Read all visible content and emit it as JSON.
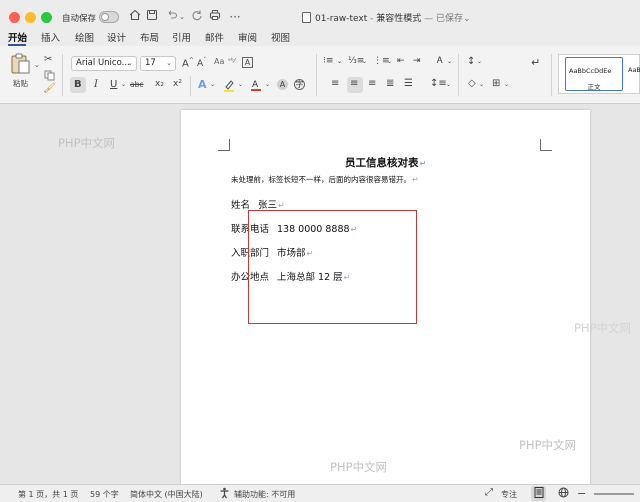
{
  "titlebar": {
    "autosave_label": "自动保存",
    "file_name": "01-raw-text",
    "separator": " - ",
    "mode": "兼容性模式",
    "status": " — 已保存",
    "status_chevron": "⌄"
  },
  "tabs": [
    "开始",
    "插入",
    "绘图",
    "设计",
    "布局",
    "引用",
    "邮件",
    "审阅",
    "视图"
  ],
  "ribbon": {
    "paste_label": "粘贴",
    "font_name": "Arial Unico...",
    "font_size": "17",
    "bold": "B",
    "italic": "I",
    "underline": "U",
    "strike": "abc",
    "subscript": "x₂",
    "superscript": "x²",
    "style_sample": "AaBbCcDdEe",
    "style_name": "正文",
    "style_next_sample": "AaBb"
  },
  "document": {
    "heading": "员工信息核对表",
    "note": "未处理前，标签长短不一样，后面的内容很容易错开。",
    "paragraph_mark": "↵",
    "fields": [
      {
        "label": "姓名",
        "value": "张三"
      },
      {
        "label": "联系电话",
        "value": "138 0000 8888"
      },
      {
        "label": "入职部门",
        "value": "市场部"
      },
      {
        "label": "办公地点",
        "value": "上海总部   12 层"
      }
    ]
  },
  "watermarks": [
    "PHP中文网",
    "PHP中文网",
    "PHP中文网",
    "PHP中文网"
  ],
  "statusbar": {
    "page": "第 1 页，共 1 页",
    "words": "59 个字",
    "language": "简体中文 (中国大陆)",
    "accessibility": "辅助功能: 不可用",
    "focus": "专注"
  },
  "colors": {
    "accent": "#2b5797",
    "red_box": "#c0393b",
    "page_bg": "#ffffff",
    "workspace_bg": "#e6e6e6"
  }
}
